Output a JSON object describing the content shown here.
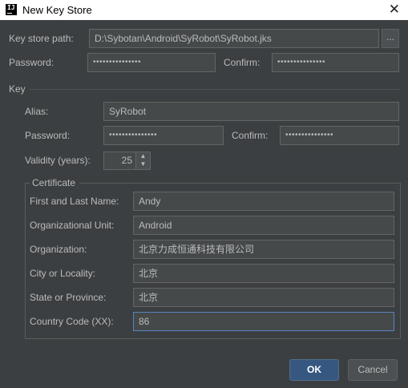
{
  "window": {
    "title": "New Key Store",
    "icon_text": "IJ"
  },
  "keystore": {
    "path_label": "Key store path:",
    "path_value": "D:\\Sybotan\\Android\\SyRobot\\SyRobot.jks",
    "browse_label": "...",
    "password_label": "Password:",
    "password_value": "•••••••••••••••",
    "confirm_label": "Confirm:",
    "confirm_value": "•••••••••••••••"
  },
  "key": {
    "section_label": "Key",
    "alias_label": "Alias:",
    "alias_value": "SyRobot",
    "password_label": "Password:",
    "password_value": "•••••••••••••••",
    "confirm_label": "Confirm:",
    "confirm_value": "•••••••••••••••",
    "validity_label": "Validity (years):",
    "validity_value": "25"
  },
  "certificate": {
    "section_label": "Certificate",
    "fields": [
      {
        "label": "First and Last Name:",
        "value": "Andy"
      },
      {
        "label": "Organizational Unit:",
        "value": "Android"
      },
      {
        "label": "Organization:",
        "value": "北京力成恒通科技有限公司"
      },
      {
        "label": "City or Locality:",
        "value": "北京"
      },
      {
        "label": "State or Province:",
        "value": "北京"
      },
      {
        "label": "Country Code (XX):",
        "value": "86"
      }
    ]
  },
  "buttons": {
    "ok": "OK",
    "cancel": "Cancel"
  },
  "colors": {
    "background": "#3c3f41",
    "field": "#45494a",
    "primary_button": "#365880",
    "focus_border": "#5a84c0"
  }
}
